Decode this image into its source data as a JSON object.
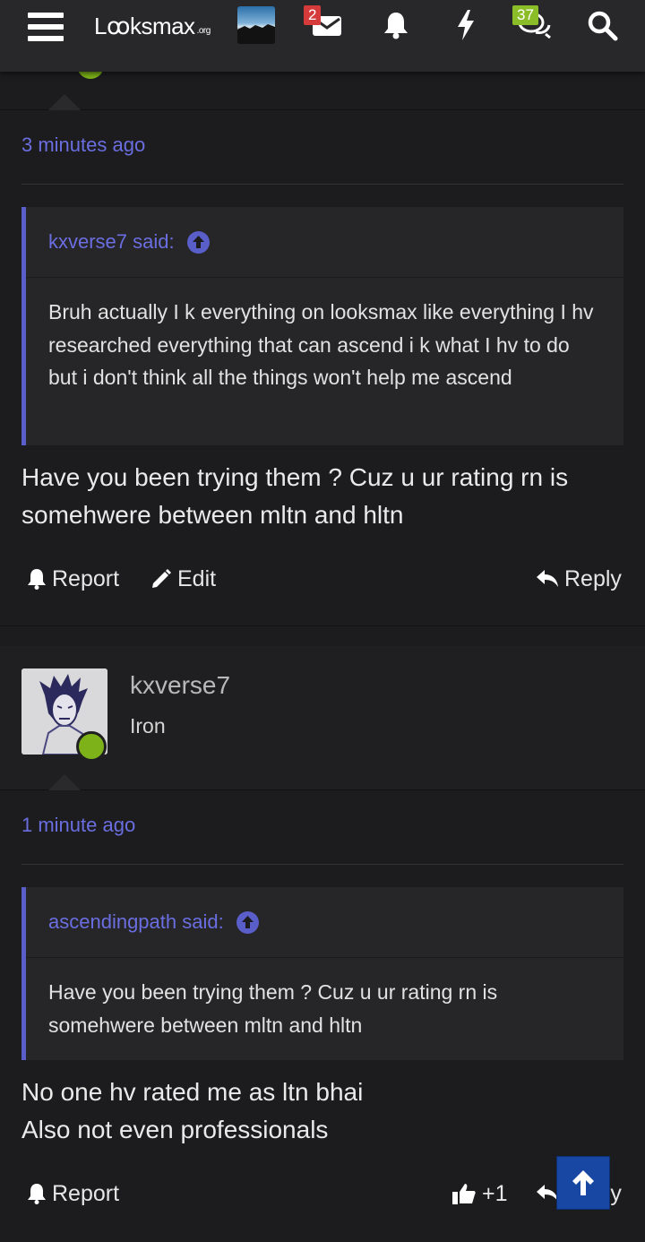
{
  "topbar": {
    "logo_text": "Lꝏksmax",
    "logo_suffix": ".org",
    "messages_badge": "2",
    "alerts_badge": "37"
  },
  "post1": {
    "timestamp": "3 minutes ago",
    "quote_author": "kxverse7 said:",
    "quote_text": "Bruh actually I k everything on looksmax like everything I hv researched everything that can ascend i k what I hv to do but i don't think all the things won't help me ascend",
    "message_line1": "Have you been trying them ? Cuz u ur rating rn is",
    "message_line2": "somehwere between mltn and hltn",
    "report_label": "Report",
    "edit_label": "Edit",
    "reply_label": "Reply"
  },
  "post2": {
    "username": "kxverse7",
    "user_title": "Iron",
    "timestamp": "1 minute ago",
    "quote_author": "ascendingpath said:",
    "quote_text": "Have you been trying them ? Cuz u ur rating rn is somehwere between mltn and hltn",
    "message_line1": "No one hv rated me as ltn bhai",
    "message_line2": "Also not even professionals",
    "report_label": "Report",
    "like_count": "+1",
    "reply_label": "Reply"
  },
  "colors": {
    "background": "#1c1c1e",
    "accent": "#6a6ee0",
    "quote_border": "#5a5ec9",
    "online": "#7db319",
    "badge_red": "#d63b3b",
    "badge_green": "#8bbd28",
    "scroll_top": "#1747a3"
  },
  "icons": [
    "menu-icon",
    "envelope-icon",
    "bell-icon",
    "bolt-icon",
    "chat-bubbles-icon",
    "search-icon",
    "arrow-up-circle-icon",
    "report-bell-icon",
    "pencil-icon",
    "reply-icon",
    "thumbs-up-icon",
    "arrow-up-icon"
  ]
}
